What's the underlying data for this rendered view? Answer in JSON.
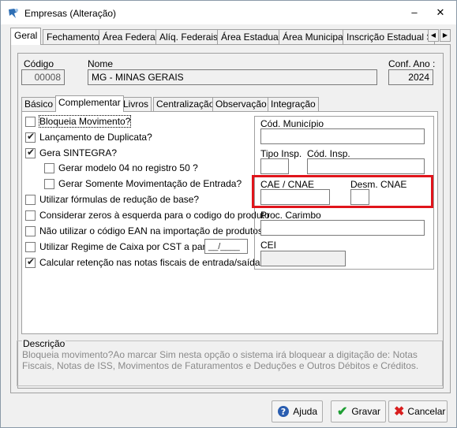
{
  "window": {
    "title": "Empresas (Alteração)",
    "minimize": "–",
    "close": "✕"
  },
  "top_tabs": [
    {
      "label": "Geral",
      "active": true
    },
    {
      "label": "Fechamento"
    },
    {
      "label": "Área Federal"
    },
    {
      "label": "Alíq. Federais"
    },
    {
      "label": "Área Estadual"
    },
    {
      "label": "Área Municipal"
    },
    {
      "label": "Inscrição Estadual S"
    }
  ],
  "header": {
    "codigo_label": "Código",
    "codigo_value": "00008",
    "nome_label": "Nome",
    "nome_value": "MG - MINAS GERAIS",
    "conf_ano_label": "Conf. Ano :",
    "conf_ano_value": "2024"
  },
  "sub_tabs": [
    {
      "label": "Básico"
    },
    {
      "label": "Complementar",
      "active": true
    },
    {
      "label": "Livros"
    },
    {
      "label": "Centralização"
    },
    {
      "label": "Observação"
    },
    {
      "label": "Integração"
    }
  ],
  "checkboxes": [
    {
      "label": "Bloqueia Movimento?",
      "checked": false
    },
    {
      "label": "Lançamento de Duplicata?",
      "checked": true
    },
    {
      "label": "Gera SINTEGRA?",
      "checked": true
    },
    {
      "label": "Gerar modelo 04 no registro 50 ?",
      "checked": false
    },
    {
      "label": "Gerar Somente Movimentação de Entrada?",
      "checked": false
    },
    {
      "label": "Utilizar fórmulas de redução de base?",
      "checked": false
    },
    {
      "label": "Considerar zeros à esquerda para o codigo do produto",
      "checked": false
    },
    {
      "label": "Não utilizar o código EAN na importação de produtos",
      "checked": false
    },
    {
      "label": "Utilizar Regime de Caixa por CST  a partir de",
      "checked": false
    },
    {
      "label": "Calcular retenção nas notas fiscais de entrada/saída",
      "checked": true
    }
  ],
  "regime_date_mask": "__/____",
  "right_fields": {
    "cod_municipio_label": "Cód. Município",
    "tipo_insp_label": "Tipo Insp.",
    "cod_insp_label": "Cód. Insp.",
    "cae_cnae_label": "CAE / CNAE",
    "desm_cnae_label": "Desm. CNAE",
    "proc_carimbo_label": "Proc. Carimbo",
    "cei_label": "CEI"
  },
  "description": {
    "title": "Descrição",
    "text": "Bloqueia movimento?Ao marcar Sim nesta opção o sistema irá bloquear a digitação de: Notas Fiscais, Notas de ISS, Movimentos de Faturamentos e Deduções e Outros Débitos e Créditos."
  },
  "buttons": {
    "help": "Ajuda",
    "save": "Gravar",
    "cancel": "Cancelar"
  },
  "colors": {
    "highlight": "#e0141b",
    "save_icon": "#1e9e33",
    "cancel_icon": "#d81e1e",
    "help_icon": "#2a5db0"
  }
}
